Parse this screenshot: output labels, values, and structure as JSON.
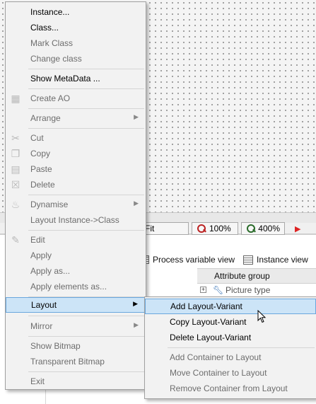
{
  "zoom": {
    "fit_label": "Fit",
    "zoom_out_label": "100%",
    "zoom_in_label": "400%"
  },
  "tabs": {
    "process_variable_view": "Process variable view",
    "instance_view": "Instance view"
  },
  "attribute_panel": {
    "header": "Attribute group",
    "rows": [
      {
        "label": "Picture type"
      }
    ]
  },
  "context_menu": {
    "items": [
      {
        "label": "Instance...",
        "enabled": true
      },
      {
        "label": "Class...",
        "enabled": true
      },
      {
        "label": "Mark Class",
        "enabled": false
      },
      {
        "label": "Change class",
        "enabled": false
      },
      {
        "label": "Show MetaData ...",
        "enabled": true
      },
      {
        "label": "Create AO",
        "enabled": false,
        "icon": "create-ao-icon"
      },
      {
        "label": "Arrange",
        "enabled": false,
        "submenu": true
      },
      {
        "label": "Cut",
        "enabled": false,
        "icon": "scissors-icon"
      },
      {
        "label": "Copy",
        "enabled": false,
        "icon": "copy-icon"
      },
      {
        "label": "Paste",
        "enabled": false,
        "icon": "paste-icon"
      },
      {
        "label": "Delete",
        "enabled": false,
        "icon": "delete-icon"
      },
      {
        "label": "Dynamise",
        "enabled": false,
        "submenu": true,
        "icon": "flame-icon"
      },
      {
        "label": "Layout Instance->Class",
        "enabled": false
      },
      {
        "label": "Edit",
        "enabled": false,
        "icon": "brush-icon"
      },
      {
        "label": "Apply",
        "enabled": false
      },
      {
        "label": "Apply as...",
        "enabled": false
      },
      {
        "label": "Apply elements as...",
        "enabled": false
      },
      {
        "label": "Layout",
        "enabled": true,
        "submenu": true,
        "highlighted": true
      },
      {
        "label": "Mirror",
        "enabled": false,
        "submenu": true
      },
      {
        "label": "Show Bitmap",
        "enabled": false
      },
      {
        "label": "Transparent Bitmap",
        "enabled": false
      },
      {
        "label": "Exit",
        "enabled": false
      }
    ]
  },
  "layout_submenu": {
    "items": [
      {
        "label": "Add Layout-Variant",
        "enabled": true,
        "highlighted": true
      },
      {
        "label": "Copy Layout-Variant",
        "enabled": true
      },
      {
        "label": "Delete Layout-Variant",
        "enabled": true
      },
      {
        "label": "Add Container to Layout",
        "enabled": false
      },
      {
        "label": "Move Container to Layout",
        "enabled": false
      },
      {
        "label": "Remove Container from Layout",
        "enabled": false
      }
    ]
  },
  "colors": {
    "menu_bg": "#f2f2f2",
    "highlight_bg": "#cce4f7",
    "highlight_border": "#6aa7dd",
    "disabled_text": "#6d6d6d"
  }
}
